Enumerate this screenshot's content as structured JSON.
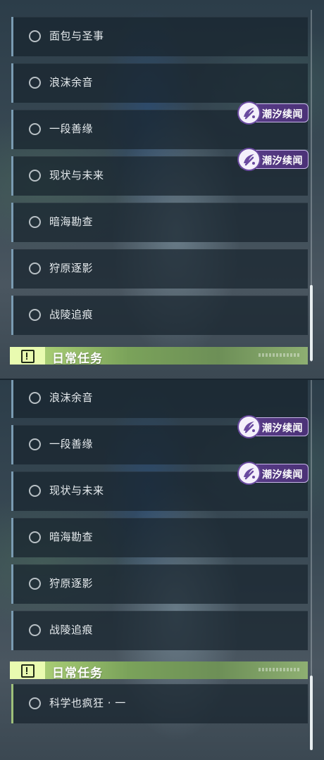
{
  "quest_list_a": [
    {
      "label": "面包与圣事"
    },
    {
      "label": "浪沫余音"
    },
    {
      "label": "一段善缘"
    },
    {
      "label": "现状与未来"
    },
    {
      "label": "暗海勘查"
    },
    {
      "label": "狩原逐影"
    },
    {
      "label": "战陵追痕"
    }
  ],
  "quest_list_b": [
    {
      "label": "浪沫余音"
    },
    {
      "label": "一段善缘"
    },
    {
      "label": "现状与未来"
    },
    {
      "label": "暗海勘查"
    },
    {
      "label": "狩原逐影"
    },
    {
      "label": "战陵追痕"
    }
  ],
  "daily_quests": [
    {
      "label": "科学也疯狂 · 一"
    }
  ],
  "badge_text": "潮汐续闻",
  "section_title": "日常任务",
  "colors": {
    "badge_bg": "#5a3d8a",
    "section_accent": "#a7cc74",
    "quest_bar": "#7a9bb2"
  },
  "icons": {
    "quest_status": "circle-ring-icon",
    "badge": "tide-story-icon",
    "section": "exclamation-box-icon"
  }
}
